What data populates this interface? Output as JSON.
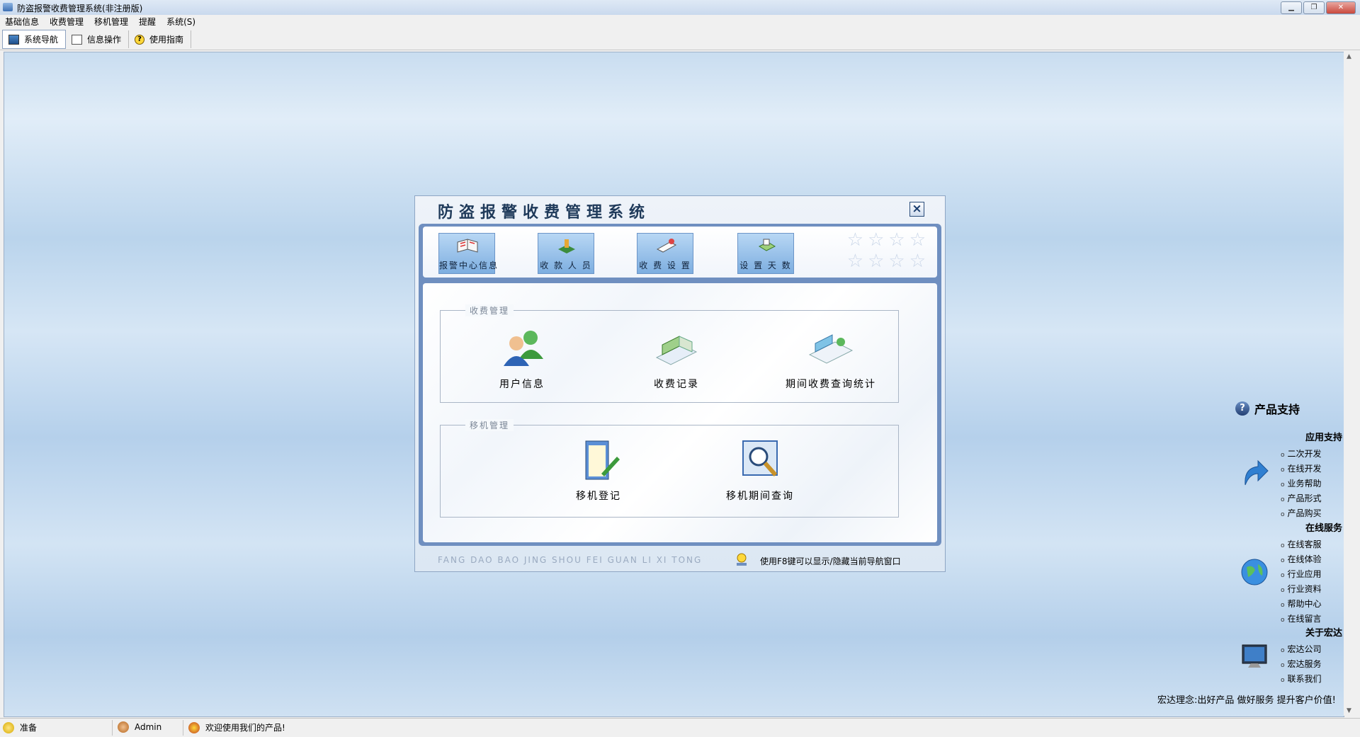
{
  "window": {
    "title": "防盗报警收费管理系统(非注册版)",
    "minimize_icon": "minimize-icon",
    "maximize_icon": "restore-icon",
    "close_icon": "close-icon"
  },
  "menu": [
    "基础信息",
    "收费管理",
    "移机管理",
    "提醒",
    "系统(S)"
  ],
  "toolbar": [
    {
      "label": "系统导航",
      "icon": "monitor-icon"
    },
    {
      "label": "信息操作",
      "icon": "document-icon"
    },
    {
      "label": "使用指南",
      "icon": "help-icon"
    }
  ],
  "dialog": {
    "title": "防盗报警收费管理系统",
    "close_label": "×",
    "top_buttons": [
      {
        "label": "报警中心信息",
        "icon": "book-icon"
      },
      {
        "label": "收 款 人 员",
        "icon": "cashier-icon"
      },
      {
        "label": "收 费 设 置",
        "icon": "settings-icon"
      },
      {
        "label": "设 置 天 数",
        "icon": "calendar-icon"
      }
    ],
    "groups": [
      {
        "title": "收费管理",
        "items": [
          {
            "label": "用户信息",
            "icon": "users-icon"
          },
          {
            "label": "收费记录",
            "icon": "records-icon"
          },
          {
            "label": "期间收费查询统计",
            "icon": "statistics-icon"
          }
        ]
      },
      {
        "title": "移机管理",
        "items": [
          {
            "label": "移机登记",
            "icon": "register-icon"
          },
          {
            "label": "移机期间查询",
            "icon": "magnifier-icon"
          }
        ]
      }
    ],
    "footer_pinyin": "FANG DAO BAO JING SHOU FEI GUAN LI XI TONG",
    "footer_hint": "使用F8键可以显示/隐藏当前导航窗口"
  },
  "support": {
    "title": "产品支持",
    "sections": [
      {
        "title": "应用支持",
        "icon": "arrow-icon",
        "links": [
          "二次开发",
          "在线开发",
          "业务帮助",
          "产品形式",
          "产品购买"
        ]
      },
      {
        "title": "在线服务",
        "icon": "globe-icon",
        "links": [
          "在线客服",
          "在线体验",
          "行业应用",
          "行业资料",
          "帮助中心",
          "在线留言"
        ]
      },
      {
        "title": "关于宏达",
        "icon": "computer-icon",
        "links": [
          "宏达公司",
          "宏达服务",
          "联系我们"
        ]
      }
    ],
    "motto": "宏达理念:出好产品 做好服务 提升客户价值!"
  },
  "status": [
    {
      "text": "准备",
      "icon": "ready-icon"
    },
    {
      "text": "Admin",
      "icon": "user-icon"
    },
    {
      "text": "欢迎使用我们的产品!",
      "icon": "welcome-icon"
    }
  ],
  "colors": {
    "accent": "#6f8fc0",
    "dialog_title": "#1f3a5a",
    "desktop": "#c9ddf0"
  }
}
